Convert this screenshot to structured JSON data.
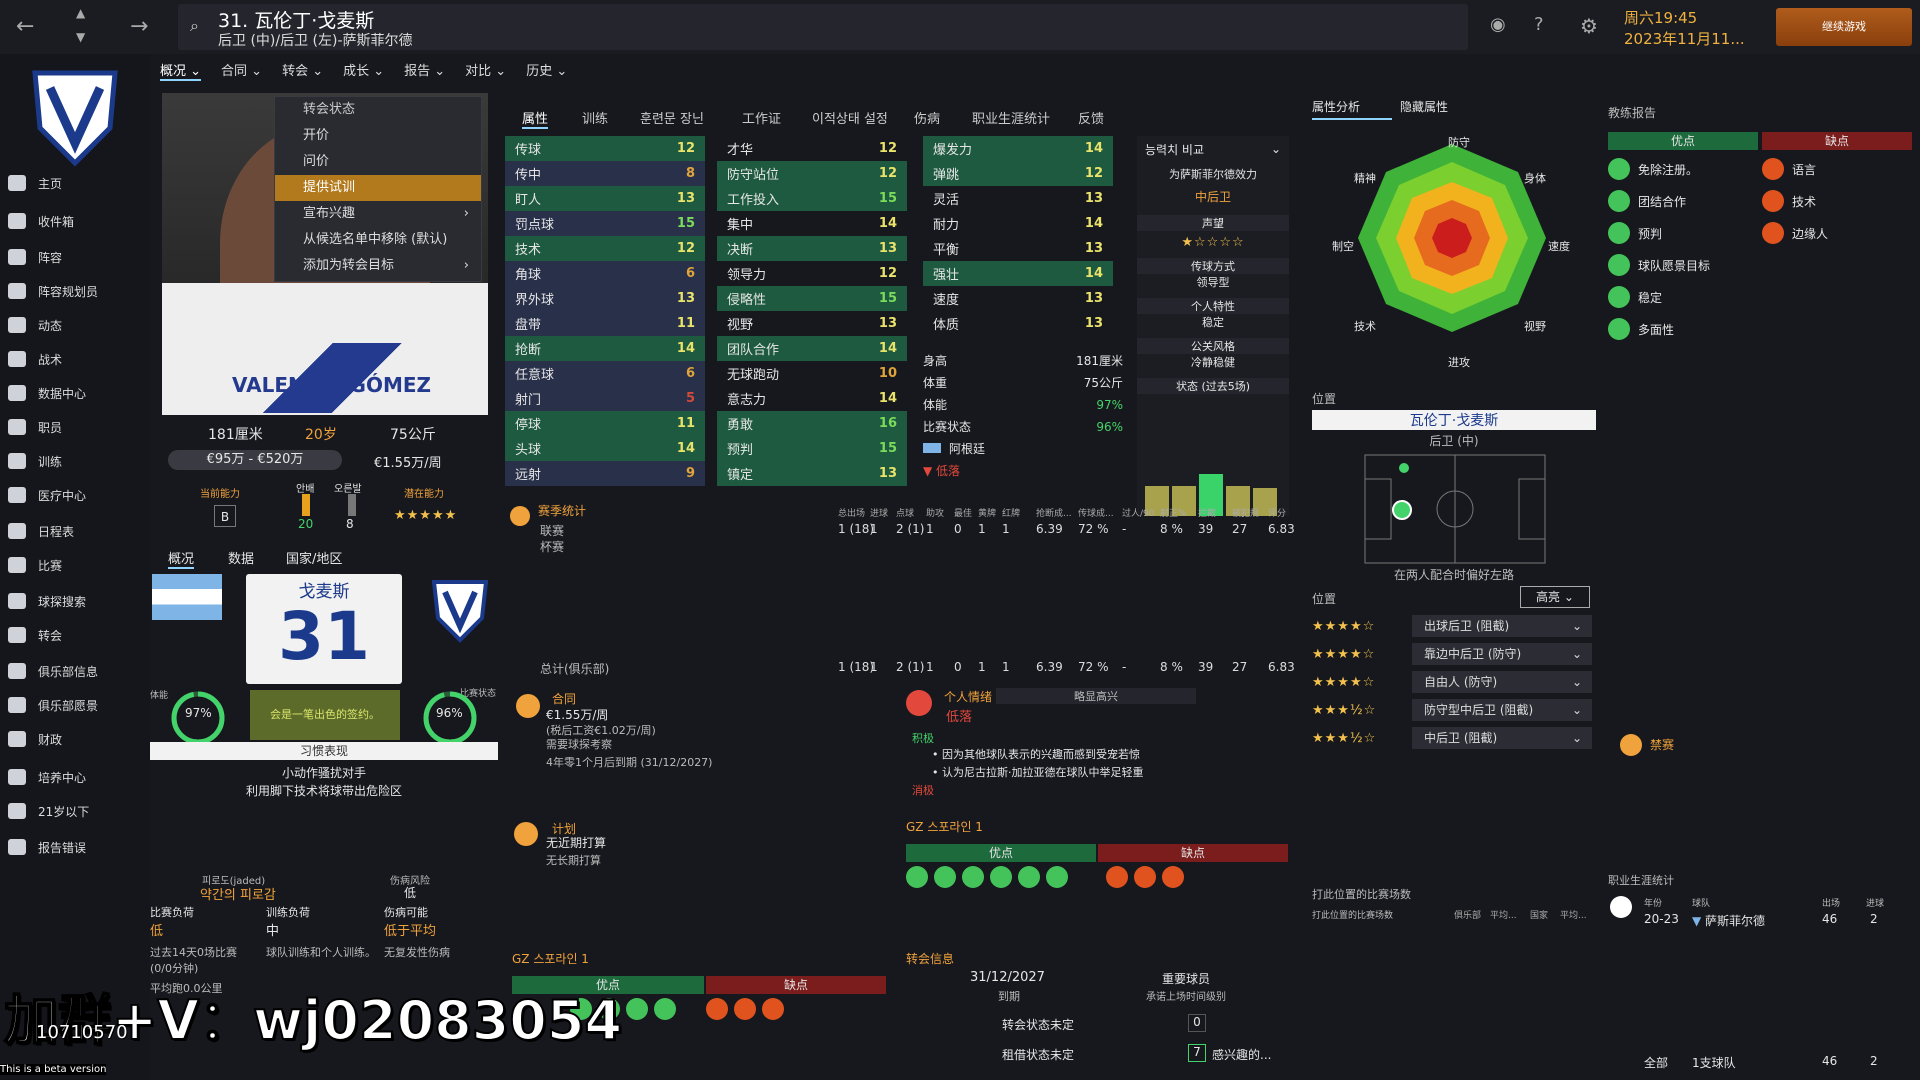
{
  "header": {
    "title": "31. 瓦伦丁·戈麦斯",
    "subtitle": "后卫 (中)/后卫 (左)-萨斯菲尔德",
    "day_time": "周六19:45",
    "date": "2023年11月11...",
    "continue": "继续游戏"
  },
  "menu": [
    "概况",
    "合同",
    "转会",
    "成长",
    "报告",
    "对比",
    "历史"
  ],
  "sidebar": [
    "主页",
    "收件箱",
    "阵容",
    "阵容规划员",
    "动态",
    "战术",
    "数据中心",
    "职员",
    "训练",
    "医疗中心",
    "日程表",
    "比赛",
    "球探搜索",
    "转会",
    "俱乐部信息",
    "俱乐部愿景",
    "财政",
    "培养中心",
    "21岁以下",
    "报告错误"
  ],
  "dropdown": {
    "header": "转会状态",
    "items": [
      "开价",
      "问价",
      "提供试训",
      "宣布兴趣",
      "从候选名单中移除 (默认)",
      "添加为转会目标"
    ]
  },
  "player": {
    "height": "181厘米",
    "age": "20岁",
    "weight": "75公斤",
    "value": "€95万 - €520万",
    "wage": "€1.55万/周",
    "ca_label": "当前能力",
    "ca": "B",
    "korean1": "안배",
    "k1val": "20",
    "korean2": "오른발",
    "k2val": "8",
    "pa_label": "潜在能力",
    "stars": "★★★★★",
    "shirt_name": "VALENTÍN GÓMEZ"
  },
  "sub_tabs": [
    "概况",
    "数据",
    "国家/地区"
  ],
  "card": {
    "name": "戈麦斯",
    "number": "31",
    "contract_note": "会是一笔出色的签约。",
    "fitness": "97%",
    "form": "96%",
    "fitness_lbl": "体能",
    "form_lbl": "比赛状态"
  },
  "habits": {
    "title": "习惯表现",
    "l1": "小动作骚扰对手",
    "l2": "利用脚下技术将球带出危险区"
  },
  "fatigue": {
    "korean": "피로도(jaded)",
    "injury_risk_lbl": "伤病风险",
    "injury_risk": "低",
    "k2": "약간의 피로감",
    "match_load": "比赛负荷",
    "match_load_v": "低",
    "train_load": "训练负荷",
    "train_load_v": "中",
    "injury_poss": "伤病可能",
    "injury_poss_v": "低于平均",
    "n1": "过去14天0场比赛",
    "n2": "(0/0分钟)",
    "n3": "球队训练和个人训练。",
    "n4": "无复发性伤病",
    "n5": "平均跑0.0公里"
  },
  "attr_tabs": [
    "属性",
    "训练",
    "훈련문 장닌",
    "工作证",
    "이적상태 설정",
    "伤病",
    "职业生涯统计",
    "反馈"
  ],
  "attr_col1": [
    [
      "传球",
      "12"
    ],
    [
      "传中",
      "8"
    ],
    [
      "盯人",
      "13"
    ],
    [
      "罚点球",
      "15"
    ],
    [
      "技术",
      "12"
    ],
    [
      "角球",
      "6"
    ],
    [
      "界外球",
      "13"
    ],
    [
      "盘带",
      "11"
    ],
    [
      "抢断",
      "14"
    ],
    [
      "任意球",
      "6"
    ],
    [
      "射门",
      "5"
    ],
    [
      "停球",
      "11"
    ],
    [
      "头球",
      "14"
    ],
    [
      "远射",
      "9"
    ]
  ],
  "attr_col2": [
    [
      "才华",
      "12"
    ],
    [
      "防守站位",
      "12"
    ],
    [
      "工作投入",
      "15"
    ],
    [
      "集中",
      "14"
    ],
    [
      "决断",
      "13"
    ],
    [
      "领导力",
      "12"
    ],
    [
      "侵略性",
      "15"
    ],
    [
      "视野",
      "13"
    ],
    [
      "团队合作",
      "14"
    ],
    [
      "无球跑动",
      "10"
    ],
    [
      "意志力",
      "14"
    ],
    [
      "勇敢",
      "16"
    ],
    [
      "预判",
      "15"
    ],
    [
      "镇定",
      "13"
    ]
  ],
  "attr_col3": [
    [
      "爆发力",
      "14"
    ],
    [
      "弹跳",
      "12"
    ],
    [
      "灵活",
      "13"
    ],
    [
      "耐力",
      "14"
    ],
    [
      "平衡",
      "13"
    ],
    [
      "强壮",
      "14"
    ],
    [
      "速度",
      "13"
    ],
    [
      "体质",
      "13"
    ]
  ],
  "phys": {
    "height_lbl": "身高",
    "height": "181厘米",
    "weight_lbl": "体重",
    "weight": "75公斤",
    "fit_lbl": "体能",
    "fit": "97%",
    "form_lbl": "比赛状态",
    "form": "96%",
    "nation": "阿根廷",
    "morale": "低落"
  },
  "side_info": {
    "dd": "능력치 비교",
    "plays_for": "为萨斯菲尔德效力",
    "position": "中后卫",
    "rep": "声望",
    "rep_stars": "★☆☆☆☆",
    "pass_style": "传球方式",
    "leadership": "领导型",
    "personality": "个人特性",
    "steady": "稳定",
    "media": "公关风格",
    "calm": "冷静稳健",
    "form5": "状态 (过去5场)"
  },
  "season": {
    "title": "赛季统计",
    "headers": [
      "总出场",
      "进球",
      "点球",
      "助攻",
      "最佳",
      "黄牌",
      "红牌",
      "抢断成...",
      "传球成...",
      "过人/90",
      "射正%",
      "拦截",
      "被犯规",
      "评分"
    ],
    "league": "联赛",
    "cup": "杯赛",
    "total": "总计(俱乐部)",
    "row": [
      "1 (18)",
      "1",
      "2 (1)",
      "1",
      "0",
      "1",
      "1",
      "6.39",
      "72 %",
      "-",
      "8 %",
      "39",
      "27",
      "6.83"
    ]
  },
  "contract": {
    "title": "合同",
    "wage": "€1.55万/周",
    "wage2": "(税后工资€1.02万/周)",
    "need": "需要球探考察",
    "expire": "4年零1个月后到期 (31/12/2027)"
  },
  "mood": {
    "title": "个人情绪",
    "state": "低落",
    "dd": "略显高兴",
    "pos": "积极",
    "b1": "因为其他球队表示的兴趣而感到受宠若惊",
    "b2": "认为尼古拉斯·加拉亚德在球队中举足轻重",
    "neg": "消极"
  },
  "plan": {
    "title": "计划",
    "l1": "无近期打算",
    "l2": "无长期打算"
  },
  "gz": {
    "title": "GZ 스포라인 1",
    "pros": "优点",
    "cons": "缺点"
  },
  "transfer": {
    "title": "转会信息",
    "date": "31/12/2027",
    "exp": "到期",
    "role": "重要球员",
    "role2": "承诺上场时间级别",
    "tstat": "转会状态未定",
    "tval": "0",
    "lstat": "租借状态未定",
    "lval": "7",
    "interest": "感兴趣的..."
  },
  "radar": {
    "tab1": "属性分析",
    "tab2": "隐藏属性",
    "labels": [
      "防守",
      "身体",
      "速度",
      "视野",
      "进攻",
      "技术",
      "制空",
      "精神"
    ]
  },
  "positions": {
    "title": "位置",
    "name": "瓦伦丁·戈麦斯",
    "role": "后卫 (中)",
    "note": "在两人配合时偏好左路",
    "title2": "位置",
    "hl": "高亮",
    "rows": [
      [
        "★★★★☆",
        "出球后卫 (阻截)"
      ],
      [
        "★★★★☆",
        "靠边中后卫 (防守)"
      ],
      [
        "★★★★☆",
        "自由人 (防守)"
      ],
      [
        "★★★½☆",
        "防守型中后卫 (阻截)"
      ],
      [
        "★★★½☆",
        "中后卫 (阻截)"
      ]
    ]
  },
  "stats_by_pos": {
    "title": "打此位置的比赛场数",
    "sub": "打此位置的比赛场数",
    "cols": [
      "俱乐部",
      "平均...",
      "国家",
      "平均..."
    ]
  },
  "coach": {
    "title": "教练报告",
    "pros": "优点",
    "cons": "缺点",
    "plist": [
      "免除注册。",
      "团结合作",
      "预判",
      "球队愿景目标",
      "稳定",
      "多面性"
    ],
    "clist": [
      "语言",
      "技术",
      "边缘人"
    ],
    "ban": "禁赛"
  },
  "career": {
    "title": "职业生涯统计",
    "h_year": "年份",
    "h_club": "球队",
    "h_apps": "出场",
    "h_goals": "进球",
    "year": "20-23",
    "club": "萨斯菲尔德",
    "apps": "46",
    "goals": "2",
    "all": "全部",
    "team": "1支球队",
    "tapps": "46",
    "tgoals": "2"
  },
  "overlay": {
    "wm": "加群+V：wj02083054",
    "count": "10710570",
    "beta": "This is a beta version"
  }
}
